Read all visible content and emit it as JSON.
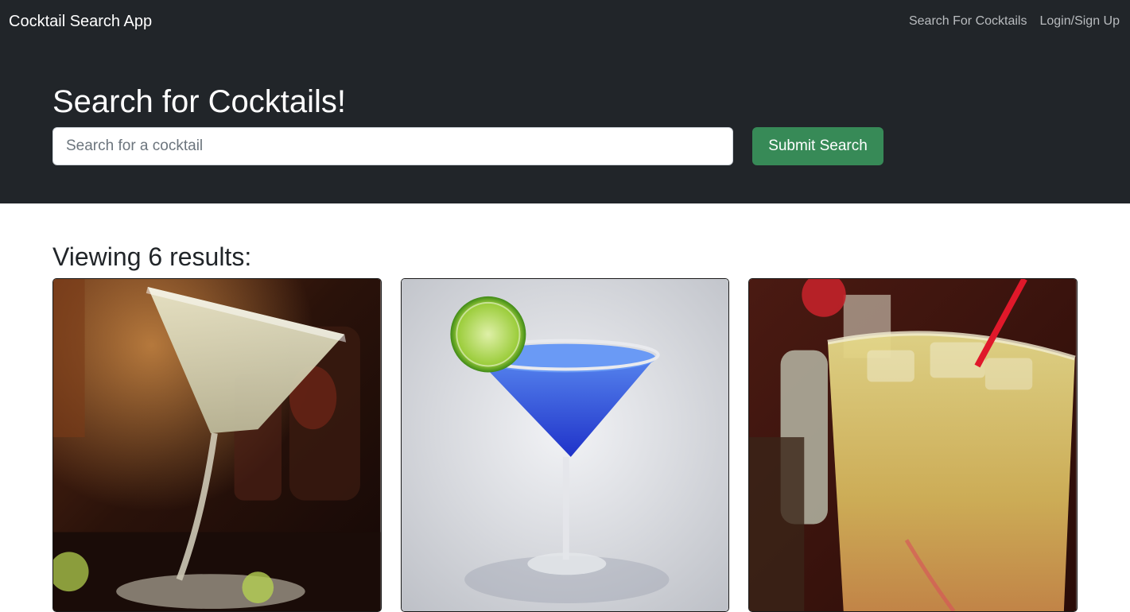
{
  "navbar": {
    "brand": "Cocktail Search App",
    "links": [
      "Search For Cocktails",
      "Login/Sign Up"
    ]
  },
  "hero": {
    "title": "Search for Cocktails!",
    "search_placeholder": "Search for a cocktail",
    "search_value": "",
    "submit_label": "Submit Search"
  },
  "results": {
    "heading": "Viewing 6 results:",
    "cards": [
      {
        "image": "margarita-martini-glass-photo"
      },
      {
        "image": "blue-cocktail-lime-photo"
      },
      {
        "image": "iced-yellow-drink-straw-photo"
      }
    ]
  },
  "colors": {
    "dark_bg": "#212529",
    "accent_green": "#378a57",
    "nav_link": "#b9bcbf"
  }
}
